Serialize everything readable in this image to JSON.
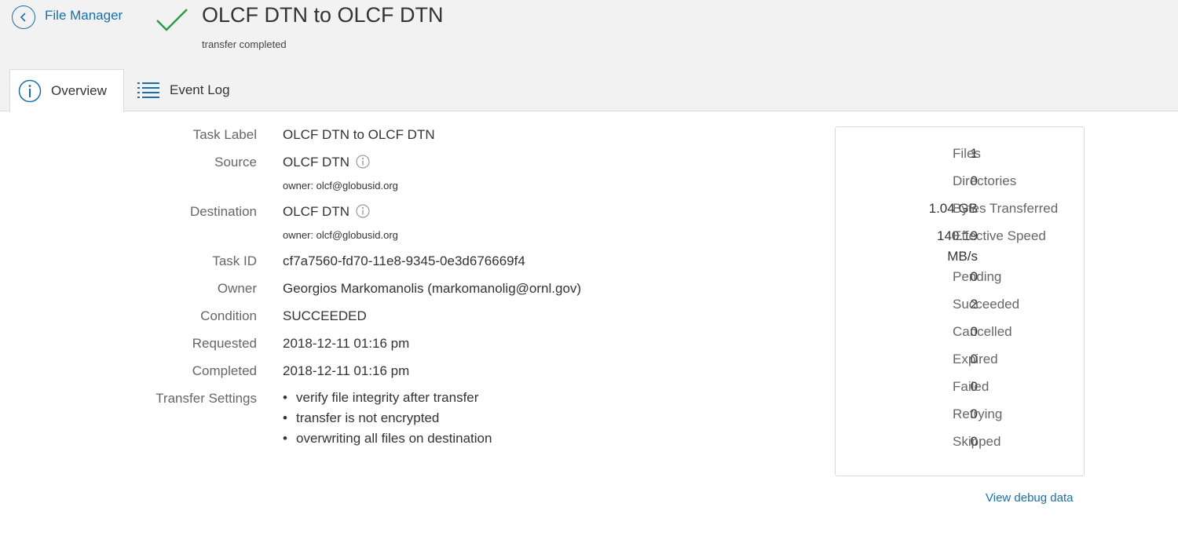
{
  "nav": {
    "back_label": "File Manager"
  },
  "task": {
    "title": "OLCF DTN to OLCF DTN",
    "status_text": "transfer completed",
    "status_color": "#2e9b3e"
  },
  "tabs": [
    {
      "label": "Overview",
      "icon": "info-circle-icon",
      "active": true
    },
    {
      "label": "Event Log",
      "icon": "list-icon",
      "active": false
    }
  ],
  "details": {
    "task_label": {
      "label": "Task Label",
      "value": "OLCF DTN to OLCF DTN"
    },
    "source": {
      "label": "Source",
      "value": "OLCF DTN",
      "owner": "owner: olcf@globusid.org"
    },
    "destination": {
      "label": "Destination",
      "value": "OLCF DTN",
      "owner": "owner: olcf@globusid.org"
    },
    "task_id": {
      "label": "Task ID",
      "value": "cf7a7560-fd70-11e8-9345-0e3d676669f4"
    },
    "owner": {
      "label": "Owner",
      "value": "Georgios Markomanolis (markomanolig@ornl.gov)"
    },
    "condition": {
      "label": "Condition",
      "value": "SUCCEEDED"
    },
    "requested": {
      "label": "Requested",
      "value": "2018-12-11 01:16 pm"
    },
    "completed": {
      "label": "Completed",
      "value": "2018-12-11 01:16 pm"
    },
    "transfer_settings": {
      "label": "Transfer Settings",
      "items": [
        "verify file integrity after transfer",
        "transfer is not encrypted",
        "overwriting all files on destination"
      ]
    }
  },
  "stats": [
    {
      "value": "1",
      "label": "Files"
    },
    {
      "value": "0",
      "label": "Directories"
    },
    {
      "value": "1.04 GB",
      "label": "Bytes Transferred"
    },
    {
      "value": "140.19",
      "value_line2": "MB/s",
      "label": "Effective Speed"
    },
    {
      "value": "0",
      "label": "Pending"
    },
    {
      "value": "2",
      "label": "Succeeded"
    },
    {
      "value": "0",
      "label": "Cancelled"
    },
    {
      "value": "0",
      "label": "Expired"
    },
    {
      "value": "0",
      "label": "Failed"
    },
    {
      "value": "0",
      "label": "Retrying"
    },
    {
      "value": "0",
      "label": "Skipped"
    }
  ],
  "debug_link": "View debug data",
  "colors": {
    "link": "#1a6fa8",
    "header_bg": "#f2f2f2",
    "label_gray": "#666666"
  }
}
